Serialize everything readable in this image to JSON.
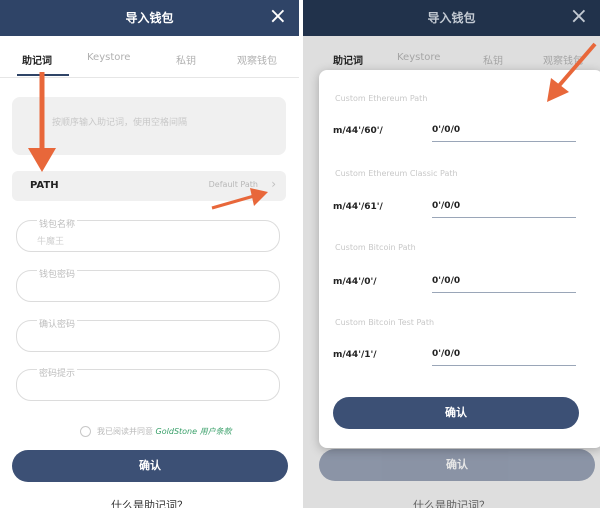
{
  "left": {
    "header": {
      "title": "导入钱包",
      "close_icon": "close-icon"
    },
    "tabs": [
      "助记词",
      "Keystore",
      "私钥",
      "观察钱包"
    ],
    "mnemonic": {
      "placeholder": "按顺序输入助记词，使用空格间隔"
    },
    "path": {
      "label": "PATH",
      "default": "Default Path",
      "chevron": "›"
    },
    "fields": [
      {
        "label": "钱包名称",
        "placeholder": "牛魔王"
      },
      {
        "label": "钱包密码",
        "placeholder": ""
      },
      {
        "label": "确认密码",
        "placeholder": ""
      },
      {
        "label": "密码提示",
        "placeholder": ""
      }
    ],
    "agreement": {
      "prefix": "我已阅读并同意",
      "link": "GoldStone 用户条款"
    },
    "confirm": "确认",
    "bottom_link": "什么是助记词？"
  },
  "right": {
    "header": {
      "title": "导入钱包",
      "close_icon": "close-icon"
    },
    "tabs": [
      "助记词",
      "Keystore",
      "私钥",
      "观察钱包"
    ],
    "sections": [
      {
        "title": "Custom Ethereum Path",
        "prefix": "m/44'/60'/",
        "value": "0'/0/0"
      },
      {
        "title": "Custom Ethereum Classic Path",
        "prefix": "m/44'/61'/",
        "value": "0'/0/0"
      },
      {
        "title": "Custom Bitcoin Path",
        "prefix": "m/44'/0'/",
        "value": "0'/0/0"
      },
      {
        "title": "Custom Bitcoin Test Path",
        "prefix": "m/44'/1'/",
        "value": "0'/0/0"
      }
    ],
    "modal_confirm": "确认",
    "confirm": "确认",
    "bottom_link": "什么是助记词？"
  },
  "colors": {
    "header": "#2f4467",
    "button": "#3c5075",
    "arrow": "#e8673a",
    "link": "#3aa06a"
  }
}
